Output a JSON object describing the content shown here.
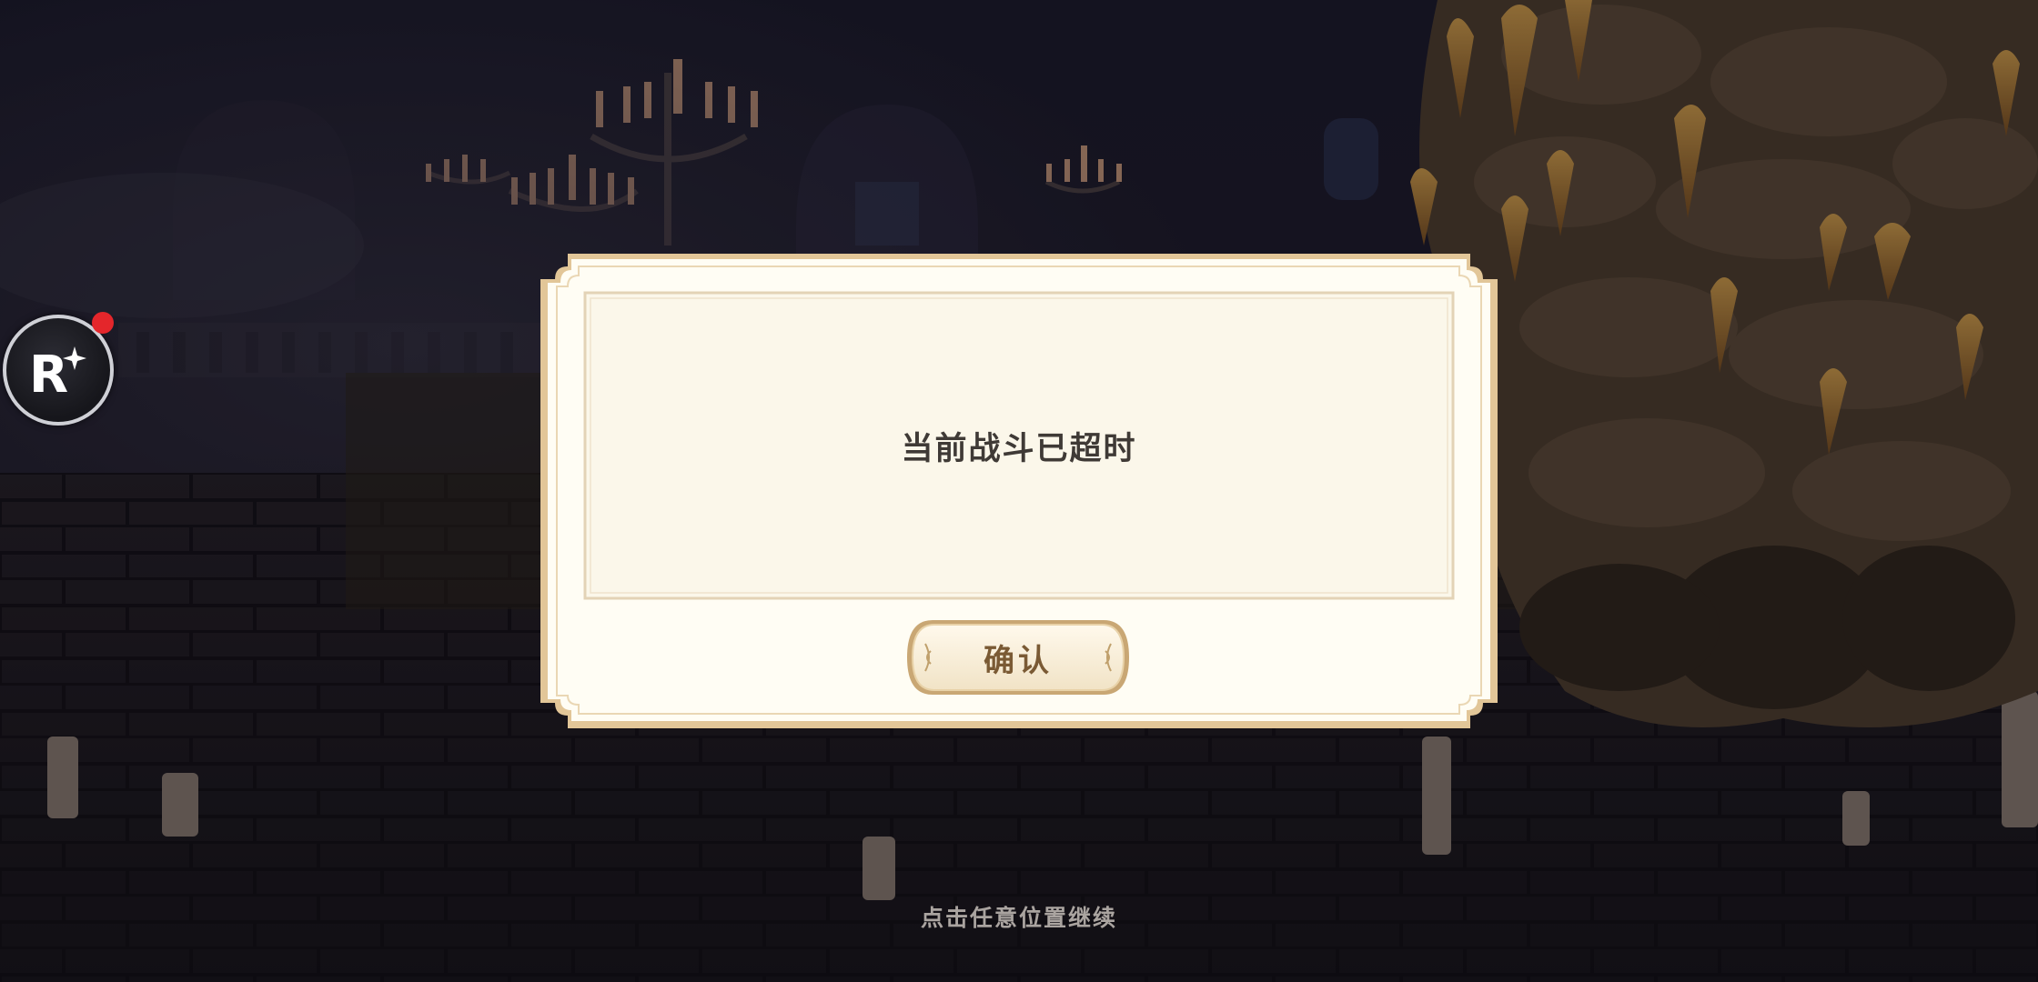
{
  "dialog": {
    "message": "当前战斗已超时",
    "confirm_label": "确认"
  },
  "hint": {
    "continue_text": "点击任意位置继续"
  },
  "floating_button": {
    "label": "R",
    "icon": "sparkle-icon",
    "has_notification": true
  },
  "colors": {
    "overlay": "#15131c",
    "dialog_border": "#d9b98a",
    "dialog_fill": "#fffdf4",
    "message_text": "#3f3a36",
    "button_text": "#7a5a34",
    "notification": "#e4262b"
  }
}
